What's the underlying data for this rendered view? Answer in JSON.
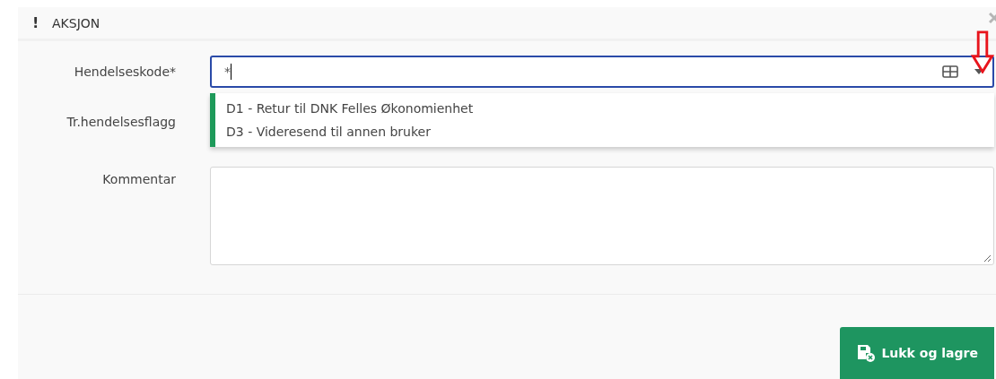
{
  "header": {
    "icon": "!",
    "title": "AKSJON"
  },
  "fields": [
    {
      "kind": "combo",
      "label": "Hendelseskode*",
      "value": "*",
      "options": [
        "D1 - Retur til DNK Felles Økonomienhet",
        "D3 - Videresend til annen bruker"
      ]
    },
    {
      "kind": "plain",
      "label": "Tr.hendelsesflagg"
    },
    {
      "kind": "textarea",
      "label": "Kommentar"
    }
  ],
  "button": {
    "label": "Lukk og lagre"
  }
}
